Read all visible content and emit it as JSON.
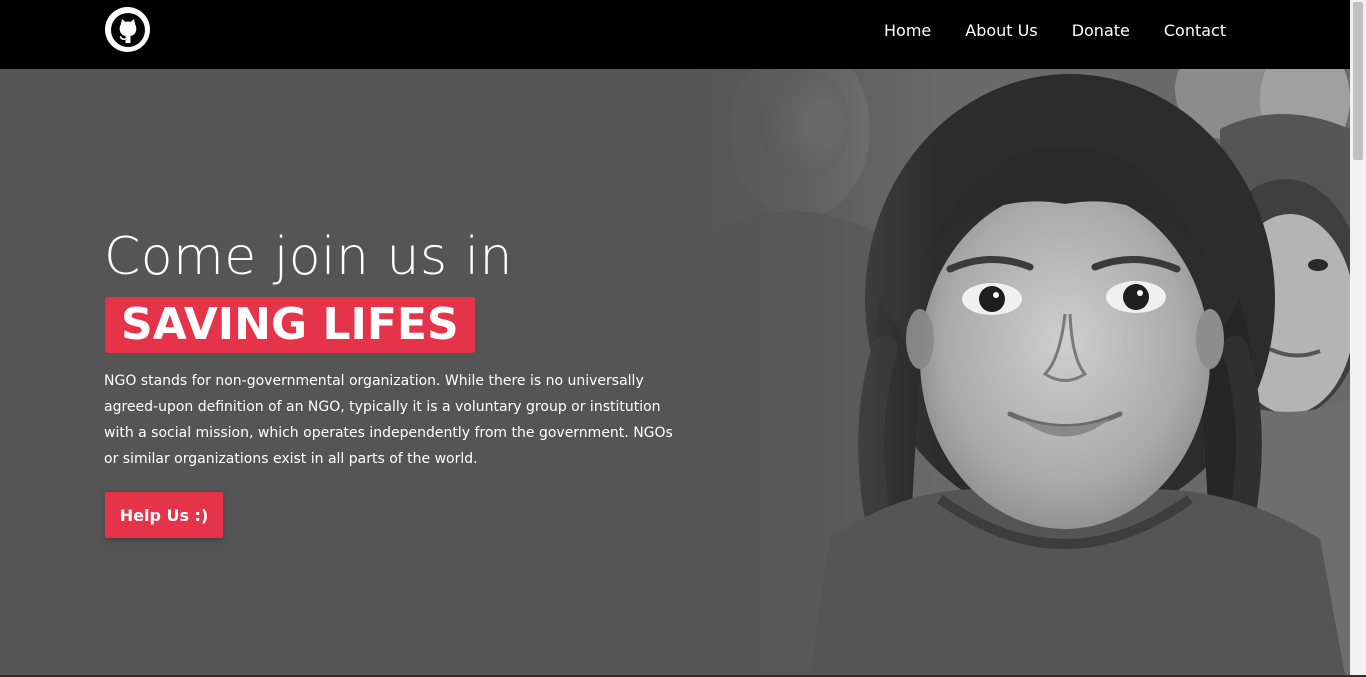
{
  "navbar": {
    "logo_icon": "github-icon",
    "links": [
      "Home",
      "About Us",
      "Donate",
      "Contact"
    ]
  },
  "hero": {
    "headline": "Come join us in",
    "highlight": "SAVING LIFES",
    "description": "NGO stands for non-governmental organization. While there is no universally agreed-upon definition of an NGO, typically it is a voluntary group or institution with a social mission, which operates independently from the government. NGOs or similar organizations exist in all parts of the world.",
    "cta_label": "Help Us  :)",
    "image_subject": "smiling-girl-photo"
  },
  "colors": {
    "accent": "#e5344a",
    "navbar_bg": "#000000",
    "hero_bg": "#555555",
    "text": "#ffffff"
  }
}
